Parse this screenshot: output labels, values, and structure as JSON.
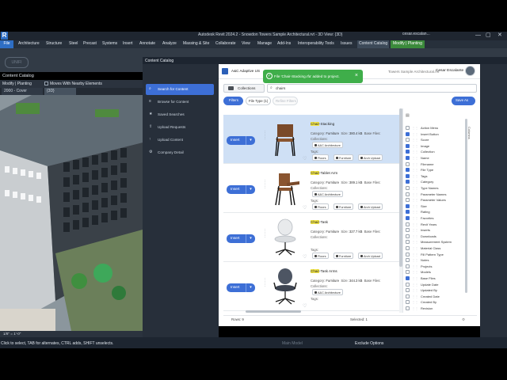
{
  "window": {
    "title": "Autodesk Revit 2024.2 - Snowdon Towers Sample Architectural.rvt - 3D View: {3D}",
    "user": "cesar.escalan...",
    "buttons": [
      "—",
      "▢",
      "✕"
    ]
  },
  "ribbon": {
    "tabs": [
      "File",
      "Architecture",
      "Structure",
      "Steel",
      "Precast",
      "Systems",
      "Insert",
      "Annotate",
      "Analyze",
      "Massing & Site",
      "Collaborate",
      "View",
      "Manage",
      "Add-Ins",
      "Interoperability Tools",
      "Issues",
      "Content Catalog",
      "Modify | Planting"
    ],
    "active_tab": "Content Catalog",
    "logo_text": "UNIFI"
  },
  "left_panel": {
    "title": "Content Catalog",
    "options_label": "Modify | Planting",
    "moves_with_nearby": "Moves With Nearby Elements",
    "view_tabs": [
      "2000 - Cover",
      "{3D}"
    ],
    "scale": "1/8\" = 1'-0\""
  },
  "dialog": {
    "title": "Content Catalog",
    "nav": [
      {
        "label": "Search for Content",
        "icon": "search-icon"
      },
      {
        "label": "Browse for Content",
        "icon": "browse-icon"
      },
      {
        "label": "Saved Searches",
        "icon": "saved-icon"
      },
      {
        "label": "Upload Requests",
        "icon": "upload-request-icon"
      },
      {
        "label": "Upload Content",
        "icon": "upload-icon"
      },
      {
        "label": "Company Detail",
        "icon": "gear-icon"
      }
    ],
    "company": "A&C Adaptive US",
    "user_name": "Cesar Escalante",
    "toast": "File 'Chair-Stacking.rfa' added to project.",
    "search_hint": "Towers Sample Architectural.rvt",
    "collections_label": "Collections",
    "search_value": "chairs",
    "filters_label": "Filters",
    "file_type_label": "File Type (1)",
    "refine_label": "Refine Filters",
    "save_as_label": "Save As",
    "insert_label": "Insert",
    "results": [
      {
        "hl": "Chair",
        "title": "-Stacking",
        "category": "Furniture",
        "size": "380.4 kB",
        "base": "Base Files:",
        "collection": "A&C Architecture",
        "tags": [
          "Floors",
          "Furniture",
          "Arch Upload"
        ],
        "selected": true
      },
      {
        "hl": "Chair",
        "title": "-Tablet Arm",
        "category": "Furniture",
        "size": "389.1 kB",
        "base": "Base Files:",
        "collection": "A&C Architecture",
        "tags": [
          "Floors",
          "Furniture",
          "Arch Upload"
        ],
        "selected": false
      },
      {
        "hl": "Chair",
        "title": "-Task",
        "category": "Furniture",
        "size": "327.7 kB",
        "base": "Base Files:",
        "collection": "",
        "tags": [
          "Floors",
          "Furniture",
          "Arch Upload"
        ],
        "selected": false
      },
      {
        "hl": "Chair",
        "title": "-Task Arms",
        "category": "Furniture",
        "size": "344.3 kB",
        "base": "Base Files:",
        "collection": "A&C Architecture",
        "tags": [
          "Floors",
          "Furniture",
          "Arch Upload"
        ],
        "selected": false
      }
    ],
    "labels": {
      "category": "Category:",
      "size": "Size:",
      "collections": "Collections:",
      "tags": "Tags:"
    },
    "columns": [
      {
        "label": "Action Menu",
        "on": false
      },
      {
        "label": "Insert Button",
        "on": true
      },
      {
        "label": "Score",
        "on": false
      },
      {
        "label": "Image",
        "on": true
      },
      {
        "label": "Collection",
        "on": true
      },
      {
        "label": "Name",
        "on": true
      },
      {
        "label": "Filename",
        "on": false
      },
      {
        "label": "File Type",
        "on": true
      },
      {
        "label": "Tags",
        "on": true
      },
      {
        "label": "Category",
        "on": true
      },
      {
        "label": "Type Names",
        "on": false
      },
      {
        "label": "Parameter Names",
        "on": false
      },
      {
        "label": "Parameter Values",
        "on": false
      },
      {
        "label": "Size",
        "on": true
      },
      {
        "label": "Rating",
        "on": true
      },
      {
        "label": "Favorites",
        "on": true
      },
      {
        "label": "Revit Years",
        "on": false
      },
      {
        "label": "Inserts",
        "on": false
      },
      {
        "label": "Downloads",
        "on": false
      },
      {
        "label": "Measurement System",
        "on": false
      },
      {
        "label": "Material Class",
        "on": false
      },
      {
        "label": "Fill Pattern Type",
        "on": false
      },
      {
        "label": "Notes",
        "on": false
      },
      {
        "label": "Projects",
        "on": false
      },
      {
        "label": "Models",
        "on": false
      },
      {
        "label": "Base Files",
        "on": true
      },
      {
        "label": "Update Date",
        "on": false
      },
      {
        "label": "Updated By",
        "on": false
      },
      {
        "label": "Created Date",
        "on": false
      },
      {
        "label": "Created By",
        "on": false
      },
      {
        "label": "Revision",
        "on": false
      }
    ],
    "columns_tab": "Columns",
    "footer": {
      "rows": "Rows: 9",
      "selected": "Selected: 1"
    }
  },
  "status": {
    "hint": "Click to select, TAB for alternates, CTRL adds, SHIFT unselects.",
    "main_model": "Main Model",
    "exclude": "Exclude Options"
  },
  "colors": {
    "accent": "#3d6fd6",
    "toast": "#3fae4a",
    "dark": "#272f3a",
    "highlight": "#f5e84a"
  }
}
